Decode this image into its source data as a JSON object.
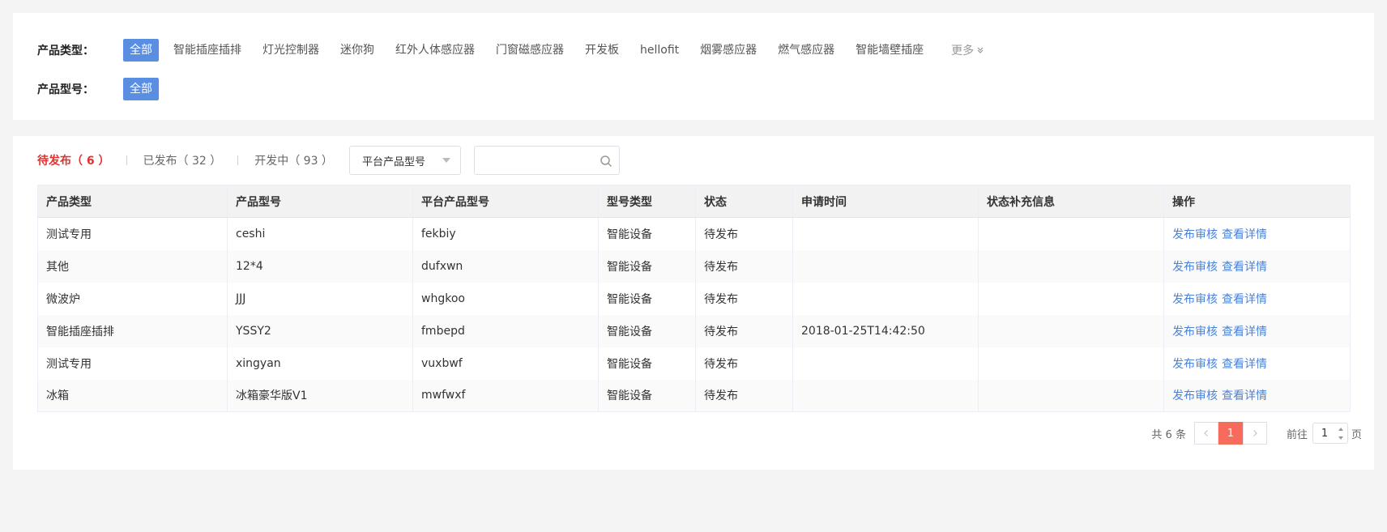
{
  "filters": {
    "type_label": "产品类型：",
    "type_chips": [
      "全部",
      "智能插座插排",
      "灯光控制器",
      "迷你狗",
      "红外人体感应器",
      "门窗磁感应器",
      "开发板",
      "hellofit",
      "烟雾感应器",
      "燃气感应器",
      "智能墙壁插座"
    ],
    "more_label": "更多",
    "model_label": "产品型号：",
    "model_chips": [
      "全部"
    ]
  },
  "tabs": [
    {
      "label": "待发布（ 6 ）"
    },
    {
      "label": "已发布（ 32 ）"
    },
    {
      "label": "开发中（ 93 ）"
    }
  ],
  "select": {
    "value": "平台产品型号"
  },
  "search": {
    "placeholder": "",
    "value": ""
  },
  "table": {
    "headers": [
      "产品类型",
      "产品型号",
      "平台产品型号",
      "型号类型",
      "状态",
      "申请时间",
      "状态补充信息",
      "操作"
    ],
    "rows": [
      {
        "type": "测试专用",
        "model": "ceshi",
        "platform_model": "fekbiy",
        "model_type": "智能设备",
        "status": "待发布",
        "apply_time": "",
        "extra": ""
      },
      {
        "type": "其他",
        "model": "12*4",
        "platform_model": "dufxwn",
        "model_type": "智能设备",
        "status": "待发布",
        "apply_time": "",
        "extra": ""
      },
      {
        "type": "微波炉",
        "model": "JJJ",
        "platform_model": "whgkoo",
        "model_type": "智能设备",
        "status": "待发布",
        "apply_time": "",
        "extra": ""
      },
      {
        "type": "智能插座插排",
        "model": "YSSY2",
        "platform_model": "fmbepd",
        "model_type": "智能设备",
        "status": "待发布",
        "apply_time": "2018-01-25T14:42:50",
        "extra": ""
      },
      {
        "type": "测试专用",
        "model": "xingyan",
        "platform_model": "vuxbwf",
        "model_type": "智能设备",
        "status": "待发布",
        "apply_time": "",
        "extra": ""
      },
      {
        "type": "冰箱",
        "model": "冰箱豪华版V1",
        "platform_model": "mwfwxf",
        "model_type": "智能设备",
        "status": "待发布",
        "apply_time": "",
        "extra": ""
      }
    ],
    "actions": [
      "发布审核",
      "查看详情"
    ]
  },
  "pagination": {
    "total_text": "共 6 条",
    "current_page": "1",
    "goto_label": "前往",
    "goto_value": "1",
    "page_unit": "页"
  },
  "colors": {
    "accent": "#5a8ee3",
    "active_tab": "#e3312d",
    "link": "#4a82d8",
    "current_page": "#f66b5b"
  },
  "icons": {
    "more": "double-chevron-down-icon",
    "select": "caret-down-icon",
    "search": "search-icon",
    "prev": "chevron-left-icon",
    "next": "chevron-right-icon"
  }
}
